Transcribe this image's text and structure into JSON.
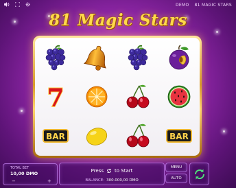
{
  "topbar": {
    "icons": [
      "sound-icon",
      "expand-icon",
      "gear-icon"
    ],
    "mode": "DEMO",
    "game_name": "81 MAGIC STARS"
  },
  "title": "81 Magic Stars",
  "reels": [
    [
      "grapes",
      "bell",
      "grapes",
      "plum"
    ],
    [
      "seven",
      "orange",
      "cherries",
      "watermelon"
    ],
    [
      "bar",
      "lemon",
      "cherries",
      "bar"
    ]
  ],
  "symbol_text": {
    "seven": "7",
    "bar": "BAR"
  },
  "bet": {
    "label": "TOTAL BET",
    "value": "10,00 DMO",
    "minus": "−",
    "plus": "+"
  },
  "spin": {
    "press": "Press",
    "to_start": "to Start"
  },
  "balance": {
    "label": "BALANCE:",
    "value": "300.000,00 DMO"
  },
  "menu_label": "MENU",
  "auto_label": "AUTO",
  "colors": {
    "gold": "#ffd94a",
    "panel_border": "#d28cff",
    "bg": "#9b2bb3"
  }
}
